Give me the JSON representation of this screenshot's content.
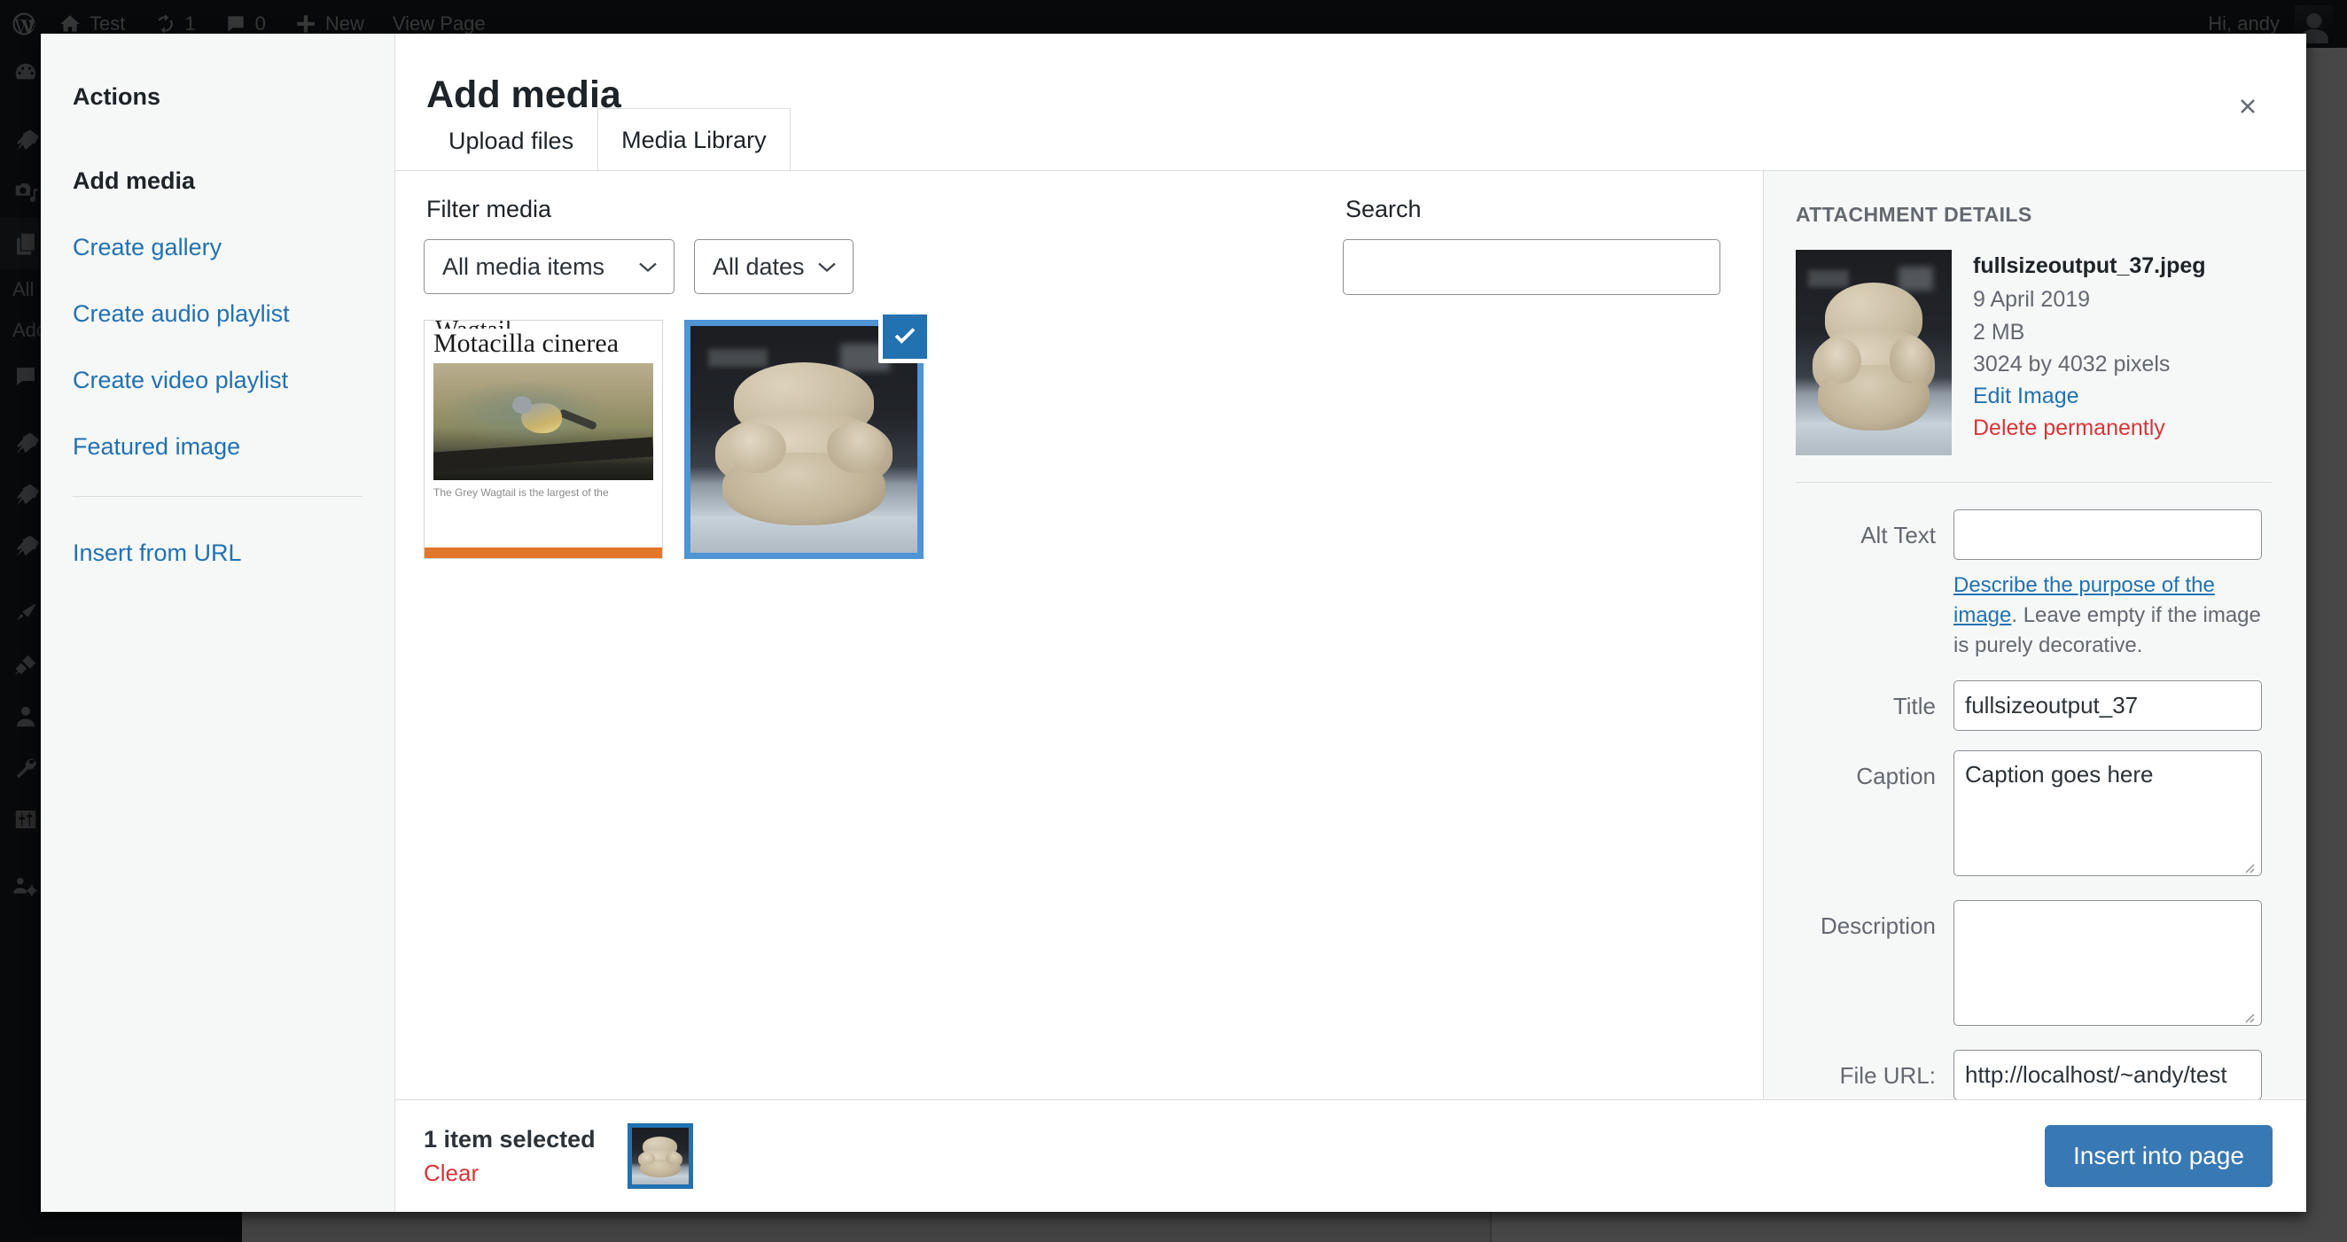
{
  "adminbar": {
    "logo_icon": "wordpress-logo-icon",
    "site_icon": "home-icon",
    "site_name": "Test",
    "updates_icon": "update-refresh-icon",
    "updates_count": "1",
    "comments_icon": "comment-bubble-icon",
    "comments_count": "0",
    "new_icon": "plus-icon",
    "new_label": "New",
    "view_page_label": "View Page",
    "greeting": "Hi, andy",
    "avatar_icon": "user-avatar"
  },
  "adminmenu": {
    "items": [
      {
        "icon": "dashboard-gauge-icon"
      },
      {
        "icon": "pin-posts-icon"
      },
      {
        "icon": "media-camera-music-icon"
      },
      {
        "icon": "pages-stack-icon",
        "current": true
      },
      {
        "icon": "comments-bubble-icon"
      },
      {
        "icon": "pin-icon"
      },
      {
        "icon": "pin-icon"
      },
      {
        "icon": "pin-icon"
      },
      {
        "icon": "appearance-brush-icon"
      },
      {
        "icon": "plugins-plug-icon"
      },
      {
        "icon": "users-person-icon"
      },
      {
        "icon": "tools-wrench-icon"
      },
      {
        "icon": "settings-sliders-icon"
      },
      {
        "icon": "group-gear-icon"
      }
    ],
    "submenu": [
      "All",
      "Add"
    ]
  },
  "modal": {
    "title": "Add media",
    "close_icon": "close-x-icon",
    "tabs": [
      {
        "label": "Upload files",
        "active": false
      },
      {
        "label": "Media Library",
        "active": true
      }
    ],
    "menu": {
      "heading": "Actions",
      "items": [
        {
          "label": "Add media",
          "active": true
        },
        {
          "label": "Create gallery",
          "active": false
        },
        {
          "label": "Create audio playlist",
          "active": false
        },
        {
          "label": "Create video playlist",
          "active": false
        },
        {
          "label": "Featured image",
          "active": false
        }
      ],
      "footer_items": [
        {
          "label": "Insert from URL",
          "active": false
        }
      ]
    },
    "toolbar": {
      "filter_label": "Filter media",
      "type_filter": {
        "value": "All media items",
        "icon": "chevron-down-icon"
      },
      "date_filter": {
        "value": "All dates",
        "icon": "chevron-down-icon"
      },
      "search_label": "Search",
      "search_value": "",
      "search_placeholder": ""
    },
    "attachments": [
      {
        "kind": "article-screenshot",
        "selected": false,
        "title": "Motacilla cinerea",
        "caption": "The Grey Wagtail is the largest of the"
      },
      {
        "kind": "figurine-photo",
        "selected": true,
        "check_icon": "checkmark-icon"
      }
    ],
    "details": {
      "heading": "ATTACHMENT DETAILS",
      "filename": "fullsizeoutput_37.jpeg",
      "date": "9 April 2019",
      "filesize": "2 MB",
      "dimensions": "3024 by 4032 pixels",
      "edit_link": "Edit Image",
      "delete_link": "Delete permanently",
      "fields": {
        "alt_text_label": "Alt Text",
        "alt_text_value": "",
        "alt_help_link": "Describe the purpose of the image",
        "alt_help_rest": ". Leave empty if the image is purely decorative.",
        "title_label": "Title",
        "title_value": "fullsizeoutput_37",
        "caption_label": "Caption",
        "caption_value": "Caption goes here",
        "description_label": "Description",
        "description_value": "",
        "file_url_label": "File URL:",
        "file_url_value": "http://localhost/~andy/test"
      }
    },
    "footer": {
      "selection_count": "1 item selected",
      "clear_label": "Clear",
      "insert_label": "Insert into page"
    }
  },
  "colors": {
    "accent": "#2271b1",
    "button": "#3879b4",
    "danger": "#d63638",
    "selection_border": "#4f94d4",
    "admin_dark": "#1d2327"
  }
}
